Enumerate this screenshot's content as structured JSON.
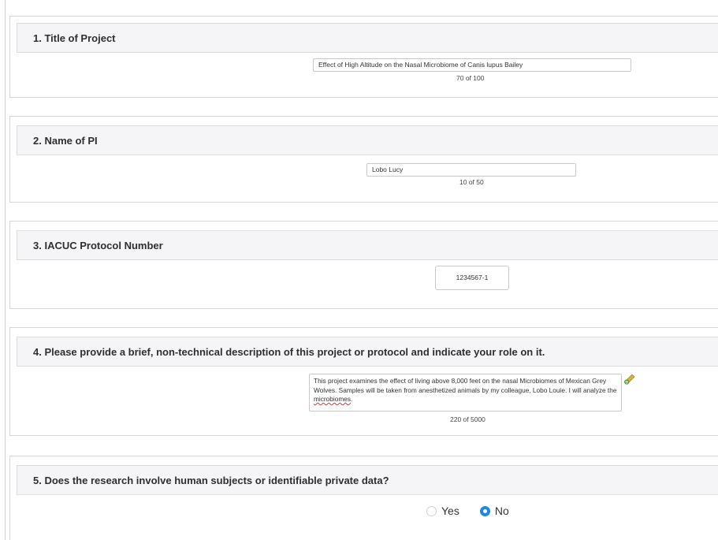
{
  "sections": [
    {
      "title": "1. Title of Project",
      "value": "Effect of High Altitude on the Nasal Microbiome of Canis lupus Bailey",
      "counter": "70 of 100"
    },
    {
      "title": "2. Name of PI",
      "value": "Lobo Lucy",
      "counter": "10 of 50"
    },
    {
      "title": "3. IACUC Protocol Number",
      "value": "1234567-1"
    },
    {
      "title": "4. Please provide a brief, non-technical description of this project or protocol and indicate your role on it.",
      "value_part1": "This project examines the effect of living above 8,000 feet on the nasal Microbiomes of Mexican Grey Wolves. Samples will be taken from anesthetized animals by my colleague, Lobo Louie.  I will analyze the ",
      "value_misspelled": "microbiomes",
      "value_part2": ".",
      "counter": "220 of 5000",
      "icon": "pencil-icon"
    },
    {
      "title": "5. Does the research involve human subjects or identifiable private data?",
      "options": [
        "Yes",
        "No"
      ],
      "selected": "No"
    }
  ],
  "colors": {
    "radio_selected": "#1e88e5",
    "header_bg": "#f5f5f7",
    "border": "#d6d6d6"
  }
}
